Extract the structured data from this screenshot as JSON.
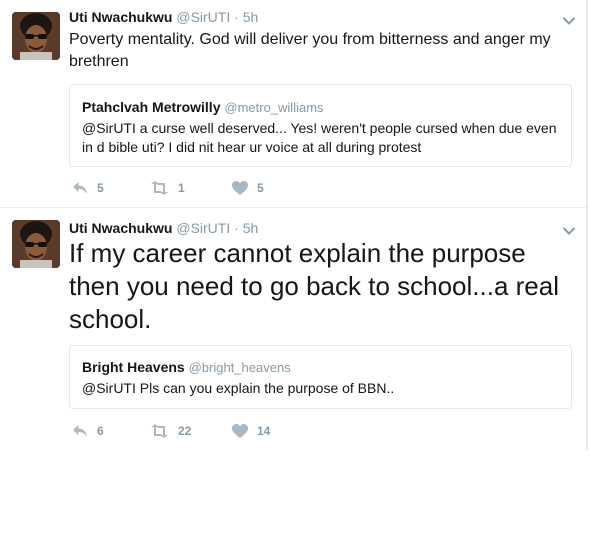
{
  "tweets": [
    {
      "author_name": "Uti Nwachukwu",
      "author_handle": "@SirUTI",
      "separator": "·",
      "time": "5h",
      "text": "Poverty mentality. God will deliver you from bitterness and anger my brethren",
      "quote": {
        "author_name": "Ptahclvah Metrowilly",
        "author_handle": "@metro_williams",
        "text": "@SirUTI a curse well deserved... Yes!  weren't people cursed when due even in d bible uti? I did nit hear ur voice at all during protest"
      },
      "replies": "5",
      "retweets": "1",
      "likes": "5"
    },
    {
      "author_name": "Uti Nwachukwu",
      "author_handle": "@SirUTI",
      "separator": "·",
      "time": "5h",
      "text": "If my career cannot explain the purpose then you need to go back to school...a real school.",
      "quote": {
        "author_name": "Bright Heavens",
        "author_handle": "@bright_heavens",
        "text": "@SirUTI Pls can you explain the purpose of BBN.."
      },
      "replies": "6",
      "retweets": "22",
      "likes": "14"
    }
  ],
  "icons": {
    "reply": "reply-icon",
    "retweet": "retweet-icon",
    "like": "heart-icon",
    "menu": "chevron-down-icon"
  },
  "colors": {
    "text": "#14171a",
    "muted": "#8899a6",
    "action_icon": "#aab8c2",
    "border": "#e1e8ed"
  }
}
